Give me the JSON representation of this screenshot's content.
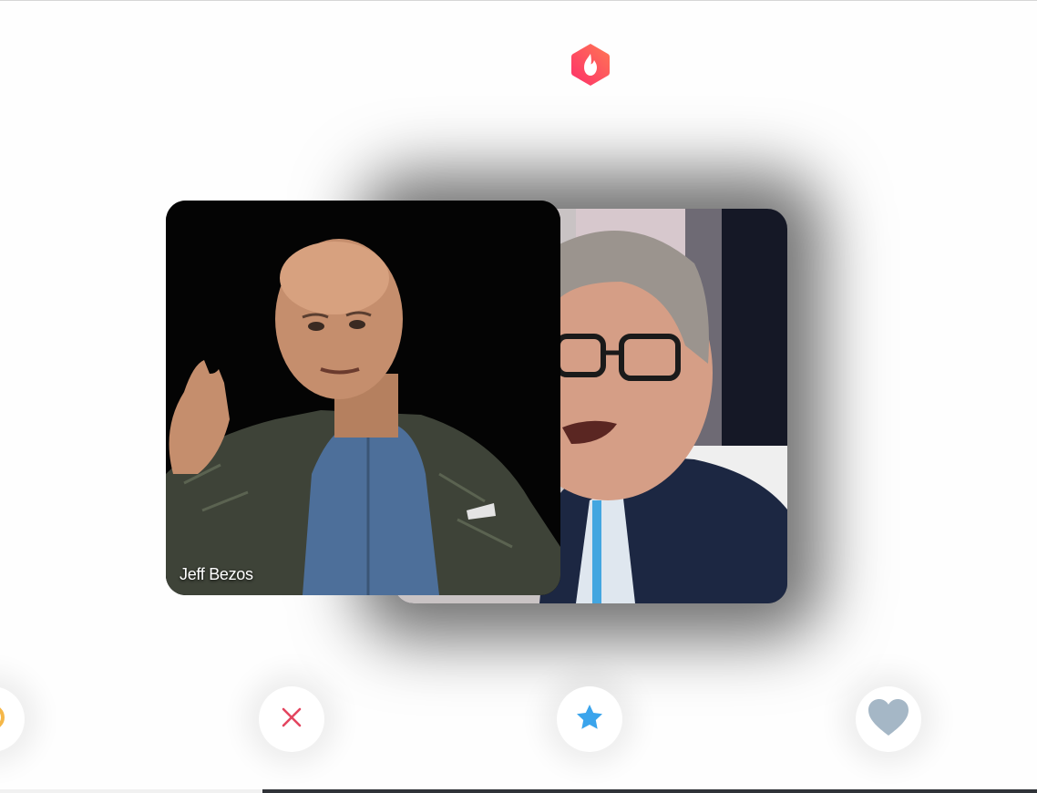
{
  "app": {
    "logo_icon": "flame-hexagon-icon",
    "brand_colors": [
      "#fd2f6a",
      "#ff7854"
    ]
  },
  "cards": {
    "front": {
      "name": "Jeff Bezos"
    }
  },
  "actions": [
    {
      "icon": "rewind-icon",
      "color": "#f5b748"
    },
    {
      "icon": "close-icon",
      "color": "#e3455f"
    },
    {
      "icon": "star-icon",
      "color": "#3aa4ec"
    },
    {
      "icon": "heart-icon",
      "color": "#a5b7c6"
    }
  ]
}
